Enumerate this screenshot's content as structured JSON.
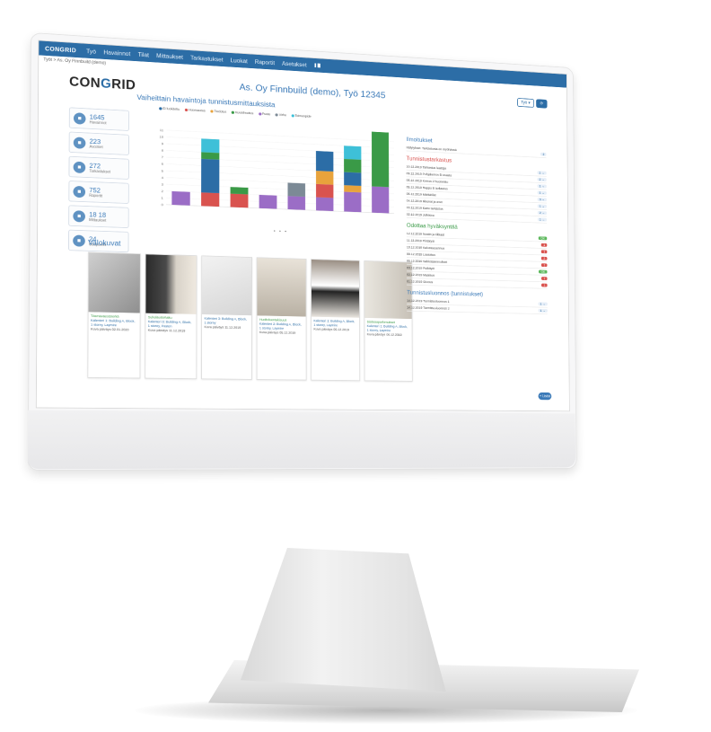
{
  "nav": {
    "brand": "CONGRID",
    "items": [
      "Työ",
      "Havainnot",
      "Tilat",
      "Mittaukset",
      "Tarkastukset",
      "Luokat",
      "Raportit",
      "Asetukset"
    ]
  },
  "breadcrumb": "Työt > As. Oy Finnbuild (demo)",
  "logo": {
    "pre": "CON",
    "mid": "G",
    "post": "RID"
  },
  "page_title": "As. Oy Finnbuild (demo), Työ 12345",
  "header_buttons": [
    "Työ ▾",
    "⟳"
  ],
  "stats": [
    {
      "icon": "clipboard-icon",
      "value": "1645",
      "label": "Havainnot"
    },
    {
      "icon": "checklist-icon",
      "value": "223",
      "label": "Avoimet"
    },
    {
      "icon": "document-icon",
      "value": "272",
      "label": "Tarkastukset"
    },
    {
      "icon": "report-icon",
      "value": "752",
      "label": "Raportit"
    },
    {
      "icon": "grid-icon",
      "value": "18   18",
      "label": "Mittaukset"
    },
    {
      "icon": "user-icon",
      "value": "24",
      "label": "Osapuolet"
    }
  ],
  "chart_title": "Vaiheittain havaintoja tunnistusmittauksista",
  "chart_data": {
    "type": "bar",
    "categories": [
      "",
      "",
      "",
      "",
      "",
      "",
      "",
      ""
    ],
    "series": [
      {
        "name": "",
        "color": "#9b6dc6",
        "values": [
          2,
          0,
          0,
          2,
          2,
          2,
          3,
          4
        ]
      },
      {
        "name": "",
        "color": "#d9534f",
        "values": [
          0,
          2,
          2,
          0,
          0,
          2,
          0,
          0
        ]
      },
      {
        "name": "",
        "color": "#7c8a96",
        "values": [
          0,
          0,
          0,
          0,
          2,
          0,
          0,
          0
        ]
      },
      {
        "name": "",
        "color": "#e8a33c",
        "values": [
          0,
          0,
          0,
          0,
          0,
          2,
          1,
          0
        ]
      },
      {
        "name": "",
        "color": "#2c6da6",
        "values": [
          0,
          5,
          0,
          0,
          0,
          3,
          2,
          0
        ]
      },
      {
        "name": "",
        "color": "#3a9a47",
        "values": [
          0,
          1,
          1,
          0,
          0,
          0,
          2,
          9
        ]
      },
      {
        "name": "",
        "color": "#3ec0d8",
        "values": [
          0,
          2,
          0,
          0,
          0,
          0,
          2,
          1
        ]
      }
    ],
    "legend": [
      {
        "label": "Ei luokiteltu",
        "color": "#2c6da6"
      },
      {
        "label": "Huomautus",
        "color": "#d9534f"
      },
      {
        "label": "Tiedotus",
        "color": "#e8a33c"
      },
      {
        "label": "Kuvailmoitus",
        "color": "#3a9a47"
      },
      {
        "label": "Puute",
        "color": "#9b6dc6"
      },
      {
        "label": "Virhe",
        "color": "#7c8a96"
      },
      {
        "label": "Toimenpide",
        "color": "#3ec0d8"
      }
    ],
    "yticks": [
      "11",
      "10",
      "9",
      "8",
      "7",
      "6",
      "5",
      "4",
      "3",
      "2",
      "1",
      "0"
    ]
  },
  "pager": "• • •",
  "gallery_title": "Valokuvat",
  "gallery": [
    {
      "tag": "Täsmäväestörerkä",
      "loc": "Kalenteri 1: Building A, Block, 1 storey, Laymire",
      "date": "Kuva päiväys 02.01.2020"
    },
    {
      "tag": "Suholaustehaku",
      "loc": "Kalenteri 3: Building A, Block, 1 storey, Pasten",
      "date": "Kuva päiväys 11.12.2019"
    },
    {
      "tag": "",
      "loc": "Kalenteri 3: Building A, Block, 1 storey",
      "date": "Kuva päiväys 11.12.2019"
    },
    {
      "tag": "Huoltoluentakisuus",
      "loc": "Kalenteri 2: Building A, Block, 1 storey, Laymire",
      "date": "Kuva päiväys 05.12.2019"
    },
    {
      "tag": "",
      "loc": "Kalenteri 1: Building A, Block, 1 storey, Laymire",
      "date": "Kuva päiväys 06.12.2019"
    },
    {
      "tag": "Sisäsaaparkenukset",
      "loc": "Kalenteri 1: Building A, Block, 1 storey, Laymire",
      "date": "Kuva päiväys 06.12.2019"
    }
  ],
  "right": {
    "notices_title": "Ilmoitukset",
    "notices": [
      {
        "text": "Hälytykset: Tarkastusta on myöhässä",
        "pill": "2"
      }
    ],
    "defects_title": "Tunnistustarkastus",
    "defects": [
      {
        "text": "10.12.2019 Tarkastus laattoja",
        "pill": "1 →"
      },
      {
        "text": "09.12.2019 Pohjakerros B-osasto",
        "pill": "2 →"
      },
      {
        "text": "06.12.2019 Kerros 2 huoneisto",
        "pill": "1 →"
      },
      {
        "text": "05.12.2019 Rappu B tarkastus",
        "pill": "1 →"
      },
      {
        "text": "05.12.2019 Märkätilat",
        "pill": "3 →"
      },
      {
        "text": "04.12.2019 Ikkunat ja ovet",
        "pill": "1 →"
      },
      {
        "text": "03.12.2019 Katto tarkastus",
        "pill": "2 →"
      },
      {
        "text": "02.12.2019 Julkisivu",
        "pill": "1 →"
      }
    ],
    "pending_title": "Odottaa hyväksyntää",
    "pending": [
      {
        "text": "12.12.2019 Nostin ja tikkaat",
        "pill": "OK"
      },
      {
        "text": "11.12.2019 Pintatyöt",
        "pill": "1"
      },
      {
        "text": "10.12.2019 Kalusteasennus",
        "pill": "1"
      },
      {
        "text": "09.12.2019 Laatoitus",
        "pill": "2"
      },
      {
        "text": "05.12.2019 Sähköasennukset",
        "pill": "1"
      },
      {
        "text": "03.12.2019 Putkityöt",
        "pill": "OK"
      },
      {
        "text": "02.12.2019 Maalaus",
        "pill": "1"
      },
      {
        "text": "01.12.2019 Siivous",
        "pill": "1"
      }
    ],
    "recent_title": "Tunnistusluonnos (tunnistukset)",
    "recent": [
      {
        "text": "14.12.2019 Tunnistusluonnos 1",
        "pill": "1 →"
      },
      {
        "text": "14.12.2019 Tunnistusluonnos 2",
        "pill": "1 →"
      }
    ],
    "add_label": "+ Lisää"
  }
}
